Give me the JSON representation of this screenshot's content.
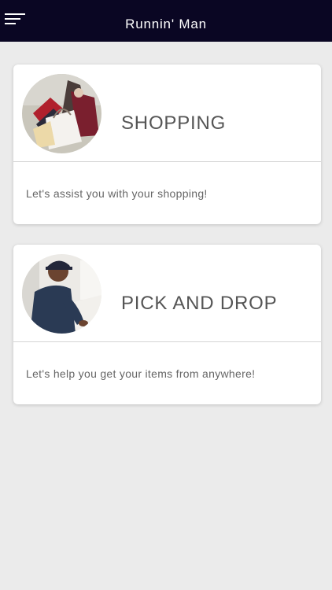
{
  "app_bar": {
    "title": "Runnin' Man",
    "menu_icon": "hamburger-menu-icon",
    "background_color": "#0a0623"
  },
  "services": [
    {
      "title": "SHOPPING",
      "description": "Let's assist you with your shopping!",
      "image": "shopping-bags-photo"
    },
    {
      "title": "PICK AND DROP",
      "description": "Let's help you get your items from anywhere!",
      "image": "delivery-man-photo"
    }
  ]
}
